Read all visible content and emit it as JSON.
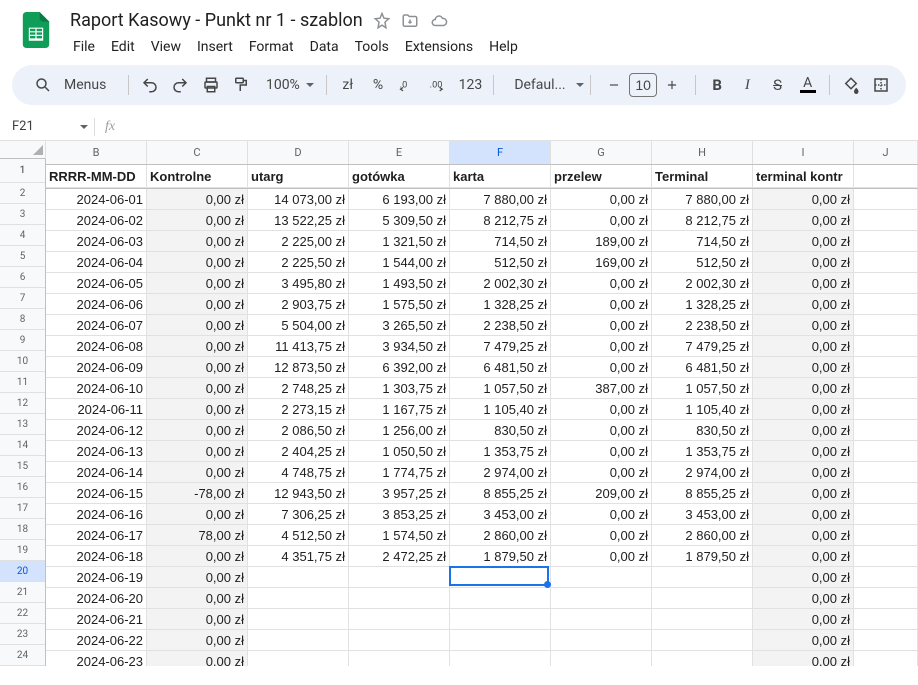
{
  "doc": {
    "title": "Raport Kasowy - Punkt nr 1 - szablon"
  },
  "menu": [
    "File",
    "Edit",
    "View",
    "Insert",
    "Format",
    "Data",
    "Tools",
    "Extensions",
    "Help"
  ],
  "toolbar": {
    "menus_label": "Menus",
    "zoom": "100%",
    "currency": "zł",
    "percent": "%",
    "num_label": "123",
    "font": "Defaul...",
    "font_size": "10"
  },
  "name_box": "F21",
  "columns": [
    {
      "letter": "B",
      "width": 101,
      "header": "RRRR-MM-DD"
    },
    {
      "letter": "C",
      "width": 101,
      "header": "Kontrolne",
      "shaded": true
    },
    {
      "letter": "D",
      "width": 101,
      "header": "utarg"
    },
    {
      "letter": "E",
      "width": 101,
      "header": "gotówka"
    },
    {
      "letter": "F",
      "width": 101,
      "header": "karta",
      "selected": true
    },
    {
      "letter": "G",
      "width": 101,
      "header": "przelew"
    },
    {
      "letter": "H",
      "width": 101,
      "header": "Terminal"
    },
    {
      "letter": "I",
      "width": 101,
      "header": "terminal kontr",
      "shaded": true
    },
    {
      "letter": "J",
      "width": 64,
      "header": ""
    }
  ],
  "selected_row_index": 20,
  "chart_data": {
    "type": "table",
    "rows": [
      {
        "n": 1,
        "B": "RRRR-MM-DD",
        "C": "Kontrolne",
        "D": "utarg",
        "E": "gotówka",
        "F": "karta",
        "G": "przelew",
        "H": "Terminal",
        "I": "terminal kontr",
        "header": true
      },
      {
        "n": 2,
        "B": "2024-06-01",
        "C": "0,00 zł",
        "D": "14 073,00 zł",
        "E": "6 193,00 zł",
        "F": "7 880,00 zł",
        "G": "0,00 zł",
        "H": "7 880,00 zł",
        "I": "0,00 zł"
      },
      {
        "n": 3,
        "B": "2024-06-02",
        "C": "0,00 zł",
        "D": "13 522,25 zł",
        "E": "5 309,50 zł",
        "F": "8 212,75 zł",
        "G": "0,00 zł",
        "H": "8 212,75 zł",
        "I": "0,00 zł"
      },
      {
        "n": 4,
        "B": "2024-06-03",
        "C": "0,00 zł",
        "D": "2 225,00 zł",
        "E": "1 321,50 zł",
        "F": "714,50 zł",
        "G": "189,00 zł",
        "H": "714,50 zł",
        "I": "0,00 zł"
      },
      {
        "n": 5,
        "B": "2024-06-04",
        "C": "0,00 zł",
        "D": "2 225,50 zł",
        "E": "1 544,00 zł",
        "F": "512,50 zł",
        "G": "169,00 zł",
        "H": "512,50 zł",
        "I": "0,00 zł"
      },
      {
        "n": 6,
        "B": "2024-06-05",
        "C": "0,00 zł",
        "D": "3 495,80 zł",
        "E": "1 493,50 zł",
        "F": "2 002,30 zł",
        "G": "0,00 zł",
        "H": "2 002,30 zł",
        "I": "0,00 zł"
      },
      {
        "n": 7,
        "B": "2024-06-06",
        "C": "0,00 zł",
        "D": "2 903,75 zł",
        "E": "1 575,50 zł",
        "F": "1 328,25 zł",
        "G": "0,00 zł",
        "H": "1 328,25 zł",
        "I": "0,00 zł"
      },
      {
        "n": 8,
        "B": "2024-06-07",
        "C": "0,00 zł",
        "D": "5 504,00 zł",
        "E": "3 265,50 zł",
        "F": "2 238,50 zł",
        "G": "0,00 zł",
        "H": "2 238,50 zł",
        "I": "0,00 zł"
      },
      {
        "n": 9,
        "B": "2024-06-08",
        "C": "0,00 zł",
        "D": "11 413,75 zł",
        "E": "3 934,50 zł",
        "F": "7 479,25 zł",
        "G": "0,00 zł",
        "H": "7 479,25 zł",
        "I": "0,00 zł"
      },
      {
        "n": 10,
        "B": "2024-06-09",
        "C": "0,00 zł",
        "D": "12 873,50 zł",
        "E": "6 392,00 zł",
        "F": "6 481,50 zł",
        "G": "0,00 zł",
        "H": "6 481,50 zł",
        "I": "0,00 zł"
      },
      {
        "n": 11,
        "B": "2024-06-10",
        "C": "0,00 zł",
        "D": "2 748,25 zł",
        "E": "1 303,75 zł",
        "F": "1 057,50 zł",
        "G": "387,00 zł",
        "H": "1 057,50 zł",
        "I": "0,00 zł"
      },
      {
        "n": 12,
        "B": "2024-06-11",
        "C": "0,00 zł",
        "D": "2 273,15 zł",
        "E": "1 167,75 zł",
        "F": "1 105,40 zł",
        "G": "0,00 zł",
        "H": "1 105,40 zł",
        "I": "0,00 zł"
      },
      {
        "n": 13,
        "B": "2024-06-12",
        "C": "0,00 zł",
        "D": "2 086,50 zł",
        "E": "1 256,00 zł",
        "F": "830,50 zł",
        "G": "0,00 zł",
        "H": "830,50 zł",
        "I": "0,00 zł"
      },
      {
        "n": 14,
        "B": "2024-06-13",
        "C": "0,00 zł",
        "D": "2 404,25 zł",
        "E": "1 050,50 zł",
        "F": "1 353,75 zł",
        "G": "0,00 zł",
        "H": "1 353,75 zł",
        "I": "0,00 zł"
      },
      {
        "n": 15,
        "B": "2024-06-14",
        "C": "0,00 zł",
        "D": "4 748,75 zł",
        "E": "1 774,75 zł",
        "F": "2 974,00 zł",
        "G": "0,00 zł",
        "H": "2 974,00 zł",
        "I": "0,00 zł"
      },
      {
        "n": 16,
        "B": "2024-06-15",
        "C": "-78,00 zł",
        "D": "12 943,50 zł",
        "E": "3 957,25 zł",
        "F": "8 855,25 zł",
        "G": "209,00 zł",
        "H": "8 855,25 zł",
        "I": "0,00 zł"
      },
      {
        "n": 17,
        "B": "2024-06-16",
        "C": "0,00 zł",
        "D": "7 306,25 zł",
        "E": "3 853,25 zł",
        "F": "3 453,00 zł",
        "G": "0,00 zł",
        "H": "3 453,00 zł",
        "I": "0,00 zł"
      },
      {
        "n": 18,
        "B": "2024-06-17",
        "C": "78,00 zł",
        "D": "4 512,50 zł",
        "E": "1 574,50 zł",
        "F": "2 860,00 zł",
        "G": "0,00 zł",
        "H": "2 860,00 zł",
        "I": "0,00 zł"
      },
      {
        "n": 19,
        "B": "2024-06-18",
        "C": "0,00 zł",
        "D": "4 351,75 zł",
        "E": "2 472,25 zł",
        "F": "1 879,50 zł",
        "G": "0,00 zł",
        "H": "1 879,50 zł",
        "I": "0,00 zł"
      },
      {
        "n": 20,
        "B": "2024-06-19",
        "C": "0,00 zł",
        "D": "",
        "E": "",
        "F": "",
        "G": "",
        "H": "",
        "I": "0,00 zł"
      },
      {
        "n": 21,
        "B": "2024-06-20",
        "C": "0,00 zł",
        "D": "",
        "E": "",
        "F": "",
        "G": "",
        "H": "",
        "I": "0,00 zł"
      },
      {
        "n": 22,
        "B": "2024-06-21",
        "C": "0,00 zł",
        "D": "",
        "E": "",
        "F": "",
        "G": "",
        "H": "",
        "I": "0,00 zł"
      },
      {
        "n": 23,
        "B": "2024-06-22",
        "C": "0,00 zł",
        "D": "",
        "E": "",
        "F": "",
        "G": "",
        "H": "",
        "I": "0,00 zł"
      },
      {
        "n": 24,
        "B": "2024-06-23",
        "C": "0,00 zł",
        "D": "",
        "E": "",
        "F": "",
        "G": "",
        "H": "",
        "I": "0,00 zł"
      }
    ]
  }
}
